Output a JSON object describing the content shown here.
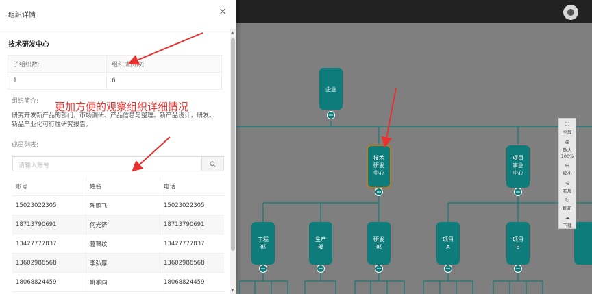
{
  "panel": {
    "title": "组织详情",
    "close_icon": "×",
    "org_name": "技术研发中心",
    "info": {
      "sub_count_label": "子组织数:",
      "member_count_label": "组织成员数:",
      "sub_count": "1",
      "member_count": "6"
    },
    "desc_label": "组织简介:",
    "desc_text": "研究开发新产品的部门，市场调研、产品信息与整理。新产品设计，研发。新品产业化可行性研究报告。",
    "member_list_label": "成员列表:",
    "search_placeholder": "请输入账号",
    "table": {
      "headers": [
        "账号",
        "姓名",
        "电话"
      ],
      "rows": [
        [
          "15023022305",
          "陈鹏飞",
          "15023022305"
        ],
        [
          "18713790691",
          "何光济",
          "18713790691"
        ],
        [
          "13427777837",
          "葛珮纹",
          "13427777837"
        ],
        [
          "13602986568",
          "李弘厚",
          "13602986568"
        ],
        [
          "18068824459",
          "姚季同",
          "18068824459"
        ]
      ]
    }
  },
  "annotation": {
    "text": "更加方便的观察组织详细情况",
    "color": "#e8322f"
  },
  "tree": {
    "node_color": "#0e7c7b",
    "nodes": {
      "root": "企业",
      "tech": "技术研发中心",
      "project_center": "项目事业中心",
      "eng": "工程部",
      "prod": "生产部",
      "rd": "研发部",
      "proj_a": "项目A",
      "proj_b": "项目B"
    }
  },
  "toolbar": {
    "fullscreen": "全屏",
    "zoom_in": "放大",
    "zoom_level": "100%",
    "zoom_out": "缩小",
    "layout": "布局",
    "refresh": "刷新",
    "download": "下载"
  }
}
